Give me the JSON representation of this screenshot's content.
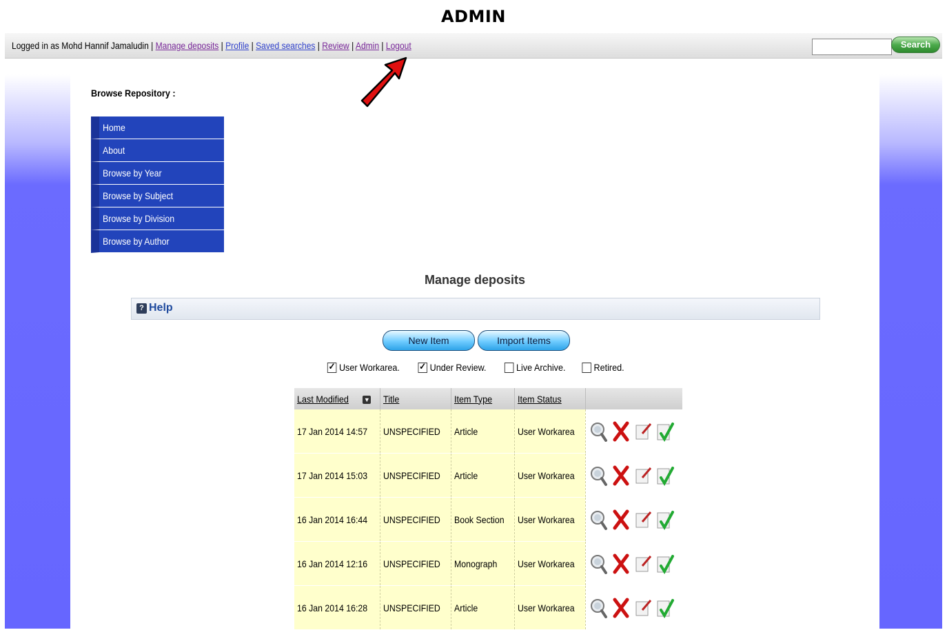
{
  "caption": "ADMIN",
  "topbar": {
    "logged_in_text": "Logged in as Mohd Hannif Jamaludin",
    "links": {
      "manage_deposits": "Manage deposits",
      "profile": "Profile",
      "saved_searches": "Saved searches",
      "review": "Review",
      "admin": "Admin",
      "logout": "Logout"
    },
    "separator": "|",
    "search_placeholder": "",
    "search_button": "Search"
  },
  "sidebar": {
    "title": "Browse Repository :",
    "items": [
      "Home",
      "About",
      "Browse by Year",
      "Browse by Subject",
      "Browse by Division",
      "Browse by Author"
    ]
  },
  "main": {
    "page_title": "Manage deposits",
    "help_label": "Help",
    "buttons": {
      "new_item": "New Item",
      "import_items": "Import Items"
    },
    "filters": [
      {
        "label": "User Workarea.",
        "checked": true
      },
      {
        "label": "Under Review.",
        "checked": true
      },
      {
        "label": "Live Archive.",
        "checked": false
      },
      {
        "label": "Retired.",
        "checked": false
      }
    ],
    "table": {
      "columns": [
        "Last Modified",
        "Title",
        "Item Type",
        "Item Status"
      ],
      "rows": [
        [
          "17 Jan 2014 14:57",
          "UNSPECIFIED",
          "Article",
          "User Workarea"
        ],
        [
          "17 Jan 2014 15:03",
          "UNSPECIFIED",
          "Article",
          "User Workarea"
        ],
        [
          "16 Jan 2014 16:44",
          "UNSPECIFIED",
          "Book Section",
          "User Workarea"
        ],
        [
          "16 Jan 2014 12:16",
          "UNSPECIFIED",
          "Monograph",
          "User Workarea"
        ],
        [
          "16 Jan 2014 16:28",
          "UNSPECIFIED",
          "Article",
          "User Workarea"
        ]
      ],
      "row_actions": [
        "view-icon",
        "delete-icon",
        "edit-icon",
        "deposit-icon"
      ]
    }
  },
  "colors": {
    "menu_bg": "#2244bb",
    "row_bg": "#ffffcc",
    "link": "#3344cc",
    "visited_link": "#7a2a9a",
    "arrow": "#e01010"
  }
}
